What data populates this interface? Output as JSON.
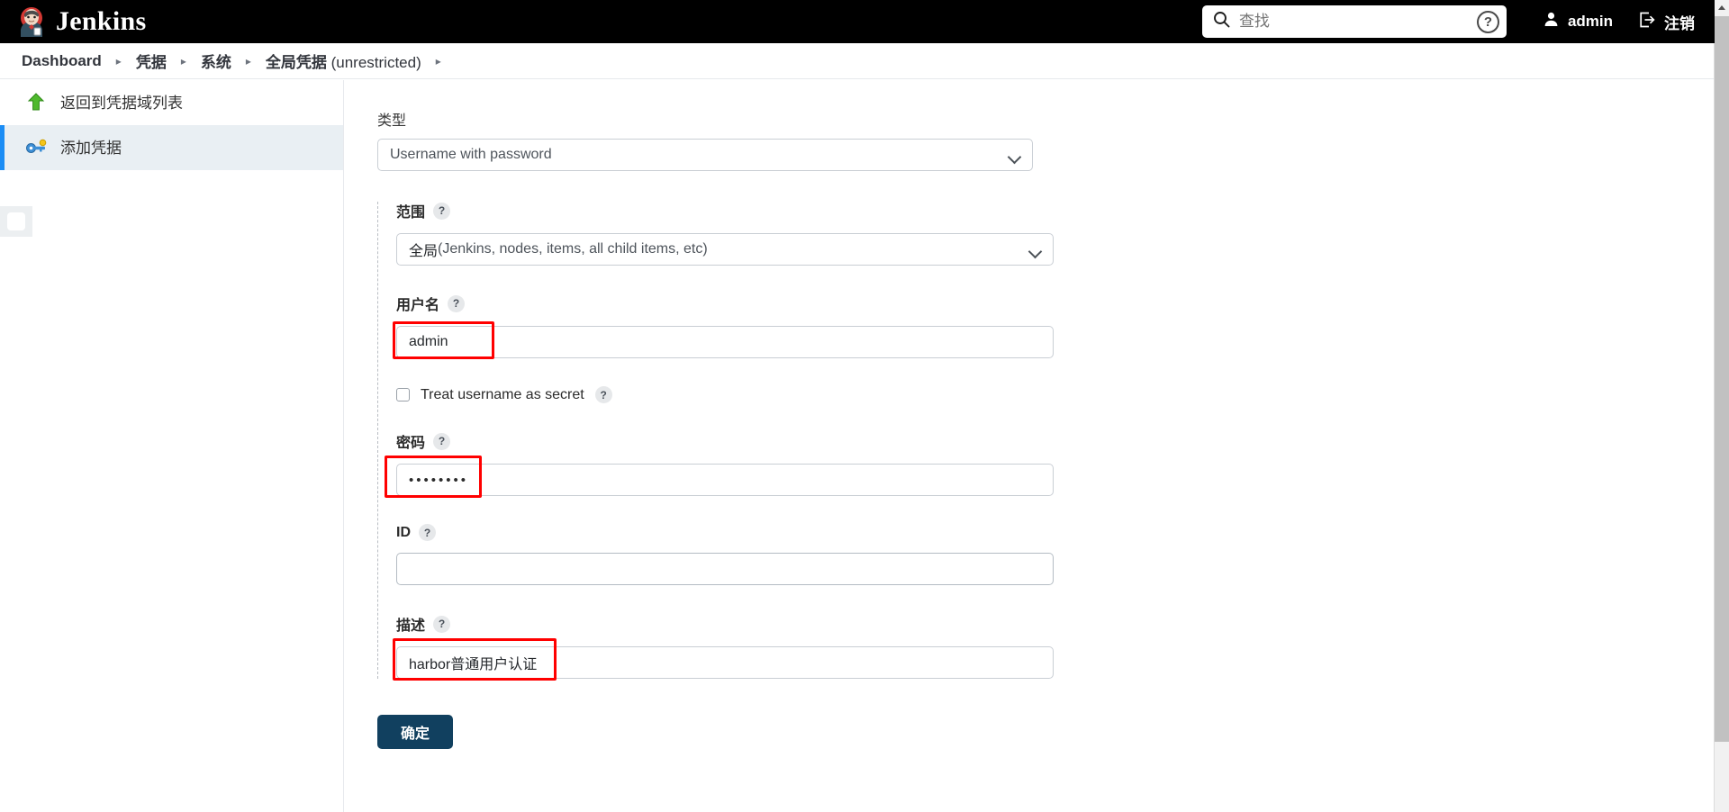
{
  "header": {
    "brand_title": "Jenkins",
    "brand_logo_icon": "jenkins-butler-logo",
    "search": {
      "placeholder": "查找",
      "value": "",
      "icon": "search-icon",
      "help_icon": "question-circle-icon"
    },
    "user": {
      "label": "admin",
      "icon": "person-icon"
    },
    "logout": {
      "label": "注销",
      "icon": "logout-icon"
    }
  },
  "breadcrumb": {
    "items": [
      {
        "label": "Dashboard",
        "sub": ""
      },
      {
        "label": "凭据",
        "sub": ""
      },
      {
        "label": "系统",
        "sub": ""
      },
      {
        "label": "全局凭据",
        "sub": " (unrestricted)"
      }
    ],
    "separator": "▸"
  },
  "sidebar": {
    "items": [
      {
        "label": "返回到凭据域列表",
        "icon": "up-arrow-icon",
        "active": false
      },
      {
        "label": "添加凭据",
        "icon": "key-icon",
        "active": true
      }
    ]
  },
  "form": {
    "type": {
      "label": "类型",
      "selected": "Username with password"
    },
    "scope": {
      "label": "范围",
      "help": "?",
      "selected_bold": "全局",
      "selected_rest": " (Jenkins, nodes, items, all child items, etc)"
    },
    "username": {
      "label": "用户名",
      "help": "?",
      "value": "admin"
    },
    "treat_as_secret": {
      "label": "Treat username as secret",
      "help": "?",
      "checked": false
    },
    "password": {
      "label": "密码",
      "help": "?",
      "value": "••••••••"
    },
    "id": {
      "label": "ID",
      "help": "?",
      "value": ""
    },
    "description": {
      "label": "描述",
      "help": "?",
      "value": "harbor普通用户认证"
    },
    "submit": {
      "label": "确定"
    }
  },
  "colors": {
    "header_bg": "#000000",
    "accent_blue": "#1b8df5",
    "submit_bg": "#11405f",
    "annotation_red": "#ff0000",
    "sidebar_active_bg": "#e9eff3"
  }
}
